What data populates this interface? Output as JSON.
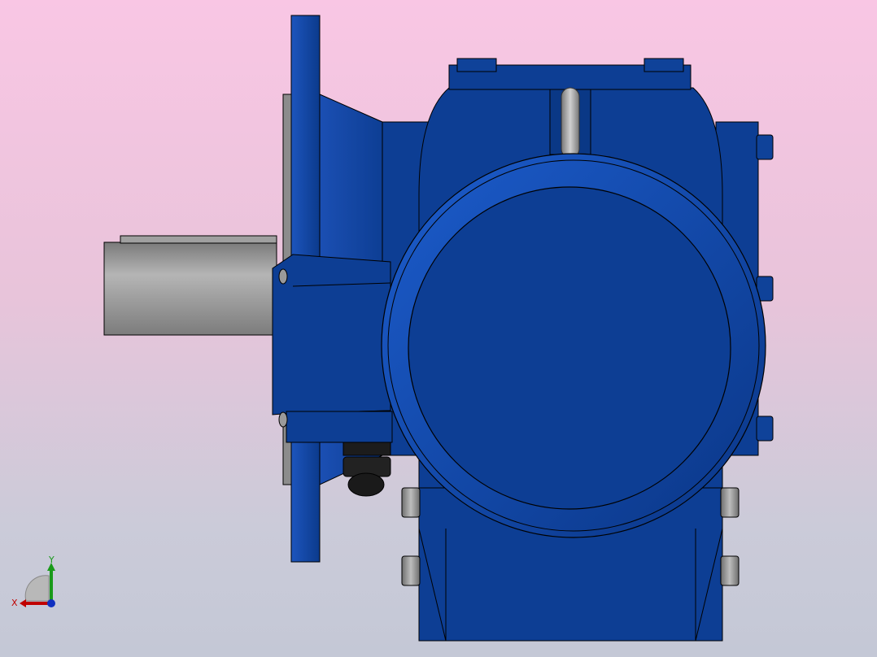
{
  "viewport": {
    "background_top": "#f9c6e4",
    "background_bottom": "#c4c8d6"
  },
  "model": {
    "body_color": "#0d3e94",
    "body_highlight": "#1b57c2",
    "body_shadow": "#072a6a",
    "shaft_color": "#9a9a9a",
    "shaft_highlight": "#c8c8c8",
    "hardware_color": "#1a1a1a",
    "outline_color": "#000000"
  },
  "triad": {
    "x_label": "X",
    "y_label": "Y",
    "x_color": "#c00000",
    "y_color": "#1a9a1a",
    "z_color": "#1030c0",
    "icon": "coordinate-triad-icon"
  }
}
